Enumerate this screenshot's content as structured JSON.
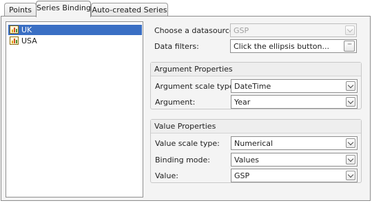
{
  "tabs": [
    {
      "label": "Points",
      "active": false
    },
    {
      "label": "Series Binding",
      "active": true
    },
    {
      "label": "Auto-created Series",
      "active": false
    }
  ],
  "series_list": {
    "items": [
      {
        "label": "UK",
        "selected": true,
        "icon": "chart-series-icon"
      },
      {
        "label": "USA",
        "selected": false,
        "icon": "chart-series-icon"
      }
    ]
  },
  "datasource": {
    "label": "Choose a datasource:",
    "value": "GSP",
    "disabled": true
  },
  "data_filters": {
    "label": "Data filters:",
    "value": "Click the ellipsis button...",
    "button_label": "···"
  },
  "argument_properties": {
    "title": "Argument Properties",
    "scale_type": {
      "label": "Argument scale type:",
      "value": "DateTime"
    },
    "argument": {
      "label": "Argument:",
      "value": "Year"
    }
  },
  "value_properties": {
    "title": "Value Properties",
    "scale_type": {
      "label": "Value scale type:",
      "value": "Numerical"
    },
    "binding_mode": {
      "label": "Binding mode:",
      "value": "Values"
    },
    "value": {
      "label": "Value:",
      "value": "GSP"
    }
  }
}
